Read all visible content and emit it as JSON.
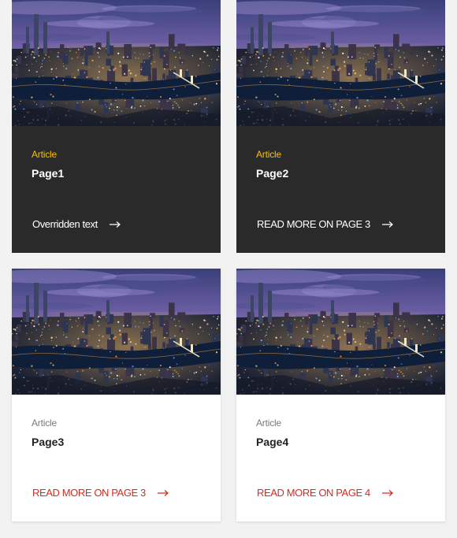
{
  "colors": {
    "dark_card_bg": "#2a2a2a",
    "light_card_bg": "#ffffff",
    "accent_yellow": "#f4c20d",
    "link_red": "#d42b1e"
  },
  "cards": [
    {
      "tag": "Article",
      "title": "Page1",
      "cta": "Overridden text",
      "theme": "dark",
      "image": "city-night-skyline"
    },
    {
      "tag": "Article",
      "title": "Page2",
      "cta": "READ MORE ON PAGE 3",
      "theme": "dark",
      "image": "city-night-skyline"
    },
    {
      "tag": "Article",
      "title": "Page3",
      "cta": "READ MORE ON PAGE 3",
      "theme": "light",
      "image": "city-night-skyline"
    },
    {
      "tag": "Article",
      "title": "Page4",
      "cta": "READ MORE ON PAGE 4",
      "theme": "light",
      "image": "city-night-skyline"
    }
  ],
  "icons": {
    "cta_arrow": "arrow-right-icon"
  }
}
